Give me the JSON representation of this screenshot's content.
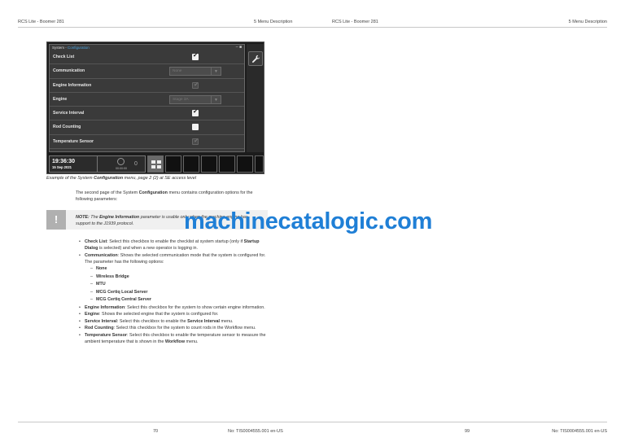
{
  "header": {
    "left1": "RCS Lite - Boomer 281",
    "mid1": "5 Menu Description",
    "left2": "RCS Lite - Boomer 281",
    "right2": "5 Menu Description"
  },
  "device": {
    "breadcrumb_1": "System",
    "breadcrumb_sep": " - ",
    "breadcrumb_2": "Configuration",
    "window_controls": "– ■",
    "rows": [
      {
        "label": "Check List",
        "control": "checkbox",
        "checked": true,
        "enabled": true
      },
      {
        "label": "Communication",
        "control": "select",
        "value": "None",
        "enabled": false
      },
      {
        "label": "Engine Information",
        "control": "checkbox",
        "checked": true,
        "enabled": false
      },
      {
        "label": "Engine",
        "control": "select",
        "value": "Stage 3A",
        "enabled": false
      },
      {
        "label": "Service Interval",
        "control": "checkbox",
        "checked": true,
        "enabled": true
      },
      {
        "label": "Rod Counting",
        "control": "checkbox",
        "checked": false,
        "enabled": true
      },
      {
        "label": "Temperature Sensor",
        "control": "checkbox",
        "checked": true,
        "enabled": false
      }
    ],
    "side_button_icon": "wrench-icon",
    "clock_time": "19:36:30",
    "clock_date": "15 Sep 2021",
    "mini_time": "00:00:00",
    "mini_count": "0"
  },
  "caption": {
    "pre": "Example of the System ",
    "bold": "Configuration",
    "post": " menu, page 2 (2) at SE access level"
  },
  "intro": {
    "pre": "The second page of the System ",
    "bold": "Configuration",
    "post": " menu contains configuration options for the following parameters:"
  },
  "note": {
    "icon": "!",
    "label": "NOTE:",
    "pre": " The ",
    "bold": "Engine Information",
    "post": " parameter is usable only when the machine engine has support to the J1939 protocol."
  },
  "watermark": "machinecatalogic.com",
  "items": [
    {
      "term": "Check List",
      "text_a": ": Select this checkbox to enable the checklist at system startup (only if ",
      "term2": "Startup Dialog",
      "text_b": " is selected) and when a new operator is logging in."
    },
    {
      "term": "Communication",
      "text_a": ": Shows the selected communication mode that the system is configured for. The parameter has the following options:",
      "term2": "",
      "text_b": ""
    },
    {
      "term": "Engine Information",
      "text_a": ": Select this checkbox for the system to show certain engine information.",
      "term2": "",
      "text_b": ""
    },
    {
      "term": "Engine",
      "text_a": ": Shows the selected engine that the system is configured for.",
      "term2": "",
      "text_b": ""
    },
    {
      "term": "Service Interval",
      "text_a": ": Select this checkbox to enable the ",
      "term2": "Service Interval",
      "text_b": " menu."
    },
    {
      "term": "Rod Counting",
      "text_a": ": Select this checkbox for the system to count rods in the Workflow menu.",
      "term2": "",
      "text_b": ""
    },
    {
      "term": "Temperature Sensor",
      "text_a": ": Select this checkbox to enable the temperature sensor to measure the ambient temperature that is shown in the ",
      "term2": "Workflow",
      "text_b": " menu."
    }
  ],
  "comm_options": [
    "None",
    "Wireless Bridge",
    "MTU",
    "MCG Certiq Local Server",
    "MCG Certiq Central Server"
  ],
  "footer": {
    "page_left": "70",
    "doc_left": "No: TIS0004555.001 en-US",
    "page_right": "99",
    "doc_right": "No: TIS0004555.001 en-US"
  }
}
